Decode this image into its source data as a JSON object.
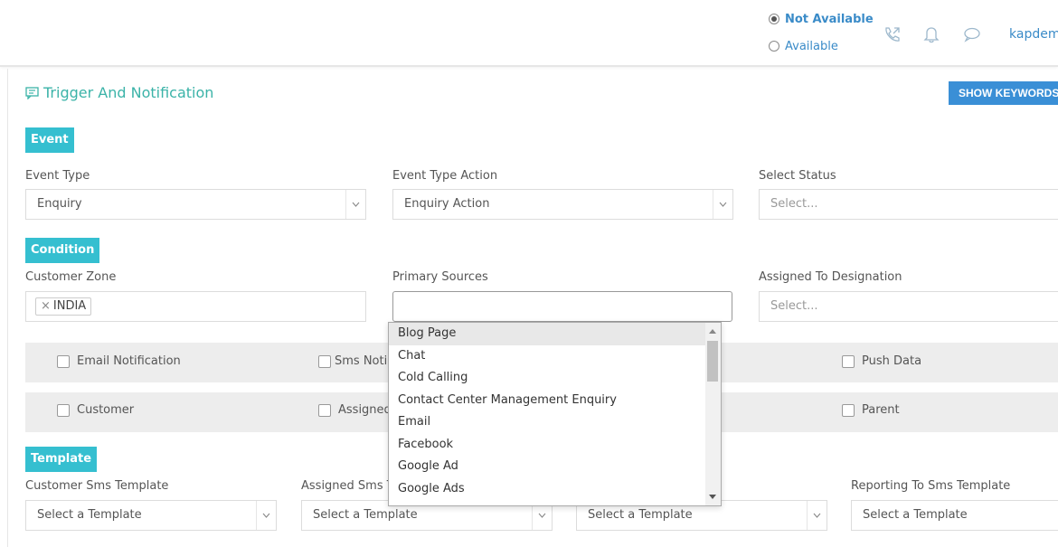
{
  "header": {
    "status_not_available": "Not Available",
    "status_available": "Available",
    "user_name": "kapdem"
  },
  "page": {
    "title": "Trigger And Notification",
    "show_keywords_button": "SHOW KEYWORDS"
  },
  "sections": {
    "event": "Event",
    "condition": "Condition",
    "template": "Template"
  },
  "event": {
    "event_type_label": "Event Type",
    "event_type_value": "Enquiry",
    "event_type_action_label": "Event Type Action",
    "event_type_action_value": "Enquiry Action",
    "select_status_label": "Select Status",
    "select_status_placeholder": "Select..."
  },
  "condition": {
    "customer_zone_label": "Customer Zone",
    "customer_zone_tag": "INDIA",
    "primary_sources_label": "Primary Sources",
    "assigned_designation_label": "Assigned To Designation",
    "assigned_designation_placeholder": "Select..."
  },
  "notifications": {
    "email": "Email Notification",
    "sms": "Sms Noti",
    "push": "Push Data",
    "customer": "Customer",
    "assigned": "Assigned",
    "parent": "Parent"
  },
  "dropdown": {
    "items": [
      "Blog Page",
      "Chat",
      "Cold Calling",
      "Contact Center Management Enquiry",
      "Email",
      "Facebook",
      "Google Ad",
      "Google Ads"
    ],
    "highlighted_index": 0
  },
  "template": {
    "customer_sms_label": "Customer Sms Template",
    "assigned_sms_label": "Assigned Sms T",
    "reporting_sms_label": "Reporting To Sms Template",
    "placeholder": "Select a Template"
  },
  "colors": {
    "accent_teal": "#35bfd0",
    "title_teal": "#3bb3a8",
    "button_blue": "#3a8fd6",
    "link_blue": "#3a8bc8"
  }
}
